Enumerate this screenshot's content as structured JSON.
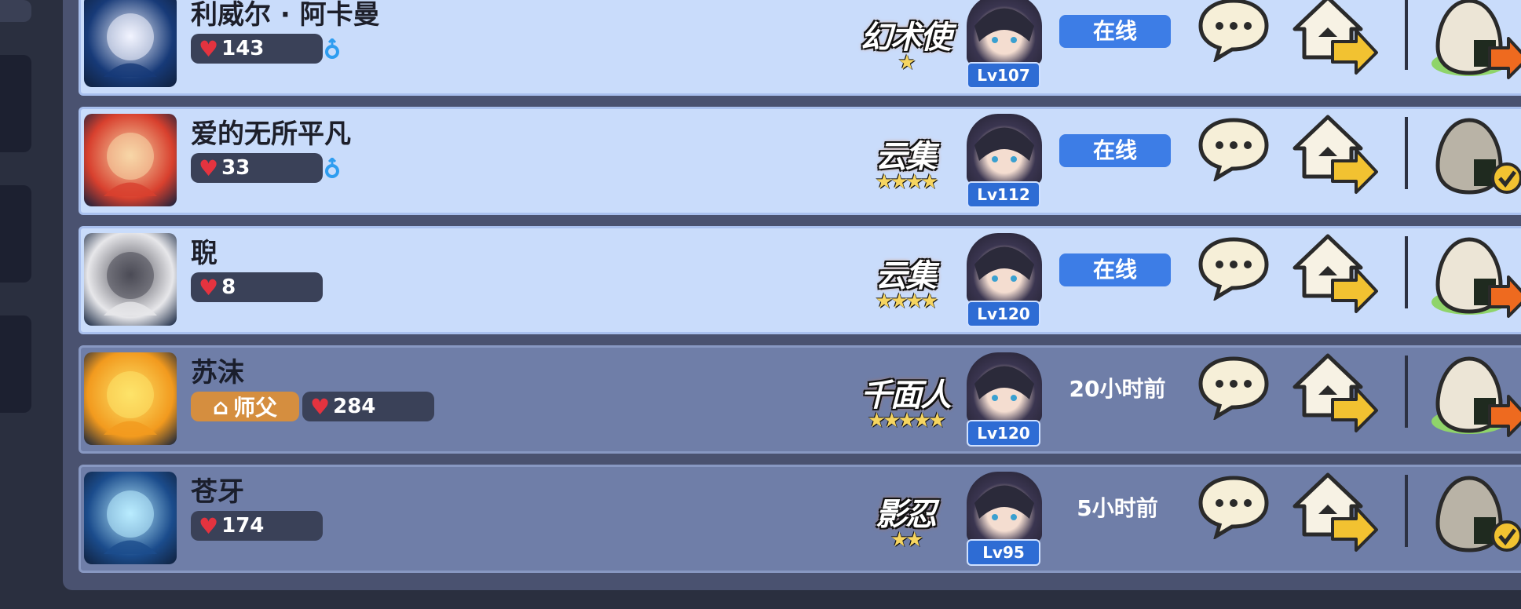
{
  "friends": [
    {
      "name": "利威尔 · 阿卡曼",
      "hearts": "143",
      "gender": "male",
      "is_master": false,
      "master_label": "",
      "title": "幻术使",
      "title_stars": "★",
      "level": "Lv107",
      "status": "在线",
      "online": true,
      "egg_state": "arrow",
      "avatar_colors": [
        "#173a78",
        "#f2f4ff"
      ]
    },
    {
      "name": "爱的无所平凡",
      "hearts": "33",
      "gender": "male",
      "is_master": false,
      "master_label": "",
      "title": "云集",
      "title_stars": "★★★★",
      "level": "Lv112",
      "status": "在线",
      "online": true,
      "egg_state": "check",
      "avatar_colors": [
        "#d8402e",
        "#f7d7a8"
      ]
    },
    {
      "name": "聣",
      "hearts": "8",
      "gender": "",
      "is_master": false,
      "master_label": "",
      "title": "云集",
      "title_stars": "★★★★",
      "level": "Lv120",
      "status": "在线",
      "online": true,
      "egg_state": "arrow",
      "avatar_colors": [
        "#e7e7ea",
        "#4b4b55"
      ]
    },
    {
      "name": "苏沫",
      "hearts": "284",
      "gender": "",
      "is_master": true,
      "master_label": "师父",
      "title": "千面人",
      "title_stars": "★★★★★",
      "level": "Lv120",
      "status": "20小时前",
      "online": false,
      "egg_state": "arrow",
      "avatar_colors": [
        "#f29a1e",
        "#fde36a"
      ]
    },
    {
      "name": "苍牙",
      "hearts": "174",
      "gender": "",
      "is_master": false,
      "master_label": "",
      "title": "影忍",
      "title_stars": "★★",
      "level": "Lv95",
      "status": "5小时前",
      "online": false,
      "egg_state": "check",
      "avatar_colors": [
        "#1b4c8c",
        "#b9ecff"
      ]
    }
  ]
}
